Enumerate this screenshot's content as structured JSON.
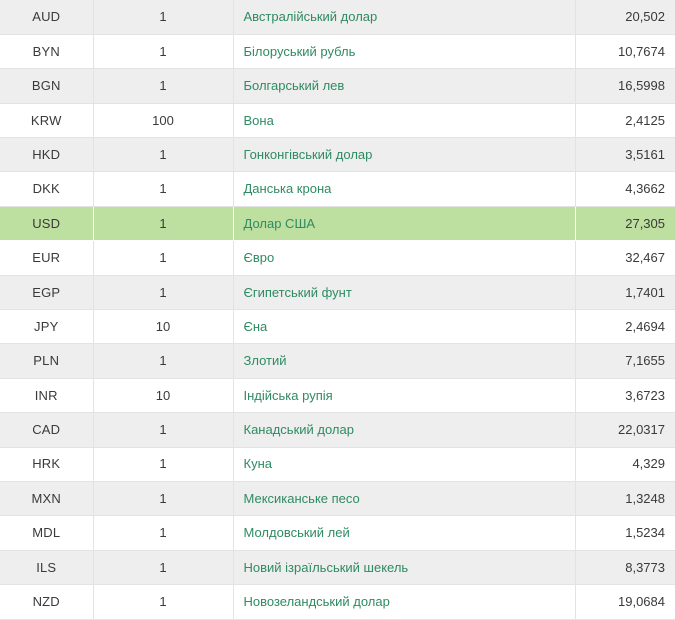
{
  "table": {
    "name": "currency-exchange-rates-table",
    "columns": [
      {
        "key": "code",
        "align": "center"
      },
      {
        "key": "units",
        "align": "center"
      },
      {
        "key": "name",
        "align": "left"
      },
      {
        "key": "rate",
        "align": "right"
      }
    ],
    "colors": {
      "row_odd_background": "#eeeeee",
      "row_even_background": "#ffffff",
      "highlight_background": "#bddf9f",
      "currency_name_text": "#2e8b62",
      "default_text": "#3a3a3a",
      "border": "#e3e3e3"
    },
    "highlighted_row_code": "USD",
    "rows": [
      {
        "code": "AUD",
        "units": "1",
        "name": "Австралійський долар",
        "rate": "20,502",
        "highlighted": false
      },
      {
        "code": "BYN",
        "units": "1",
        "name": "Білоруський рубль",
        "rate": "10,7674",
        "highlighted": false
      },
      {
        "code": "BGN",
        "units": "1",
        "name": "Болгарський лев",
        "rate": "16,5998",
        "highlighted": false
      },
      {
        "code": "KRW",
        "units": "100",
        "name": "Вона",
        "rate": "2,4125",
        "highlighted": false
      },
      {
        "code": "HKD",
        "units": "1",
        "name": "Гонконгівський долар",
        "rate": "3,5161",
        "highlighted": false
      },
      {
        "code": "DKK",
        "units": "1",
        "name": "Данська крона",
        "rate": "4,3662",
        "highlighted": false
      },
      {
        "code": "USD",
        "units": "1",
        "name": "Долар США",
        "rate": "27,305",
        "highlighted": true
      },
      {
        "code": "EUR",
        "units": "1",
        "name": "Євро",
        "rate": "32,467",
        "highlighted": false
      },
      {
        "code": "EGP",
        "units": "1",
        "name": "Єгипетський фунт",
        "rate": "1,7401",
        "highlighted": false
      },
      {
        "code": "JPY",
        "units": "10",
        "name": "Єна",
        "rate": "2,4694",
        "highlighted": false
      },
      {
        "code": "PLN",
        "units": "1",
        "name": "Злотий",
        "rate": "7,1655",
        "highlighted": false
      },
      {
        "code": "INR",
        "units": "10",
        "name": "Індійська рупія",
        "rate": "3,6723",
        "highlighted": false
      },
      {
        "code": "CAD",
        "units": "1",
        "name": "Канадський долар",
        "rate": "22,0317",
        "highlighted": false
      },
      {
        "code": "HRK",
        "units": "1",
        "name": "Куна",
        "rate": "4,329",
        "highlighted": false
      },
      {
        "code": "MXN",
        "units": "1",
        "name": "Мексиканське песо",
        "rate": "1,3248",
        "highlighted": false
      },
      {
        "code": "MDL",
        "units": "1",
        "name": "Молдовський лей",
        "rate": "1,5234",
        "highlighted": false
      },
      {
        "code": "ILS",
        "units": "1",
        "name": "Новий ізраїльський шекель",
        "rate": "8,3773",
        "highlighted": false
      },
      {
        "code": "NZD",
        "units": "1",
        "name": "Новозеландський долар",
        "rate": "19,0684",
        "highlighted": false
      }
    ]
  }
}
